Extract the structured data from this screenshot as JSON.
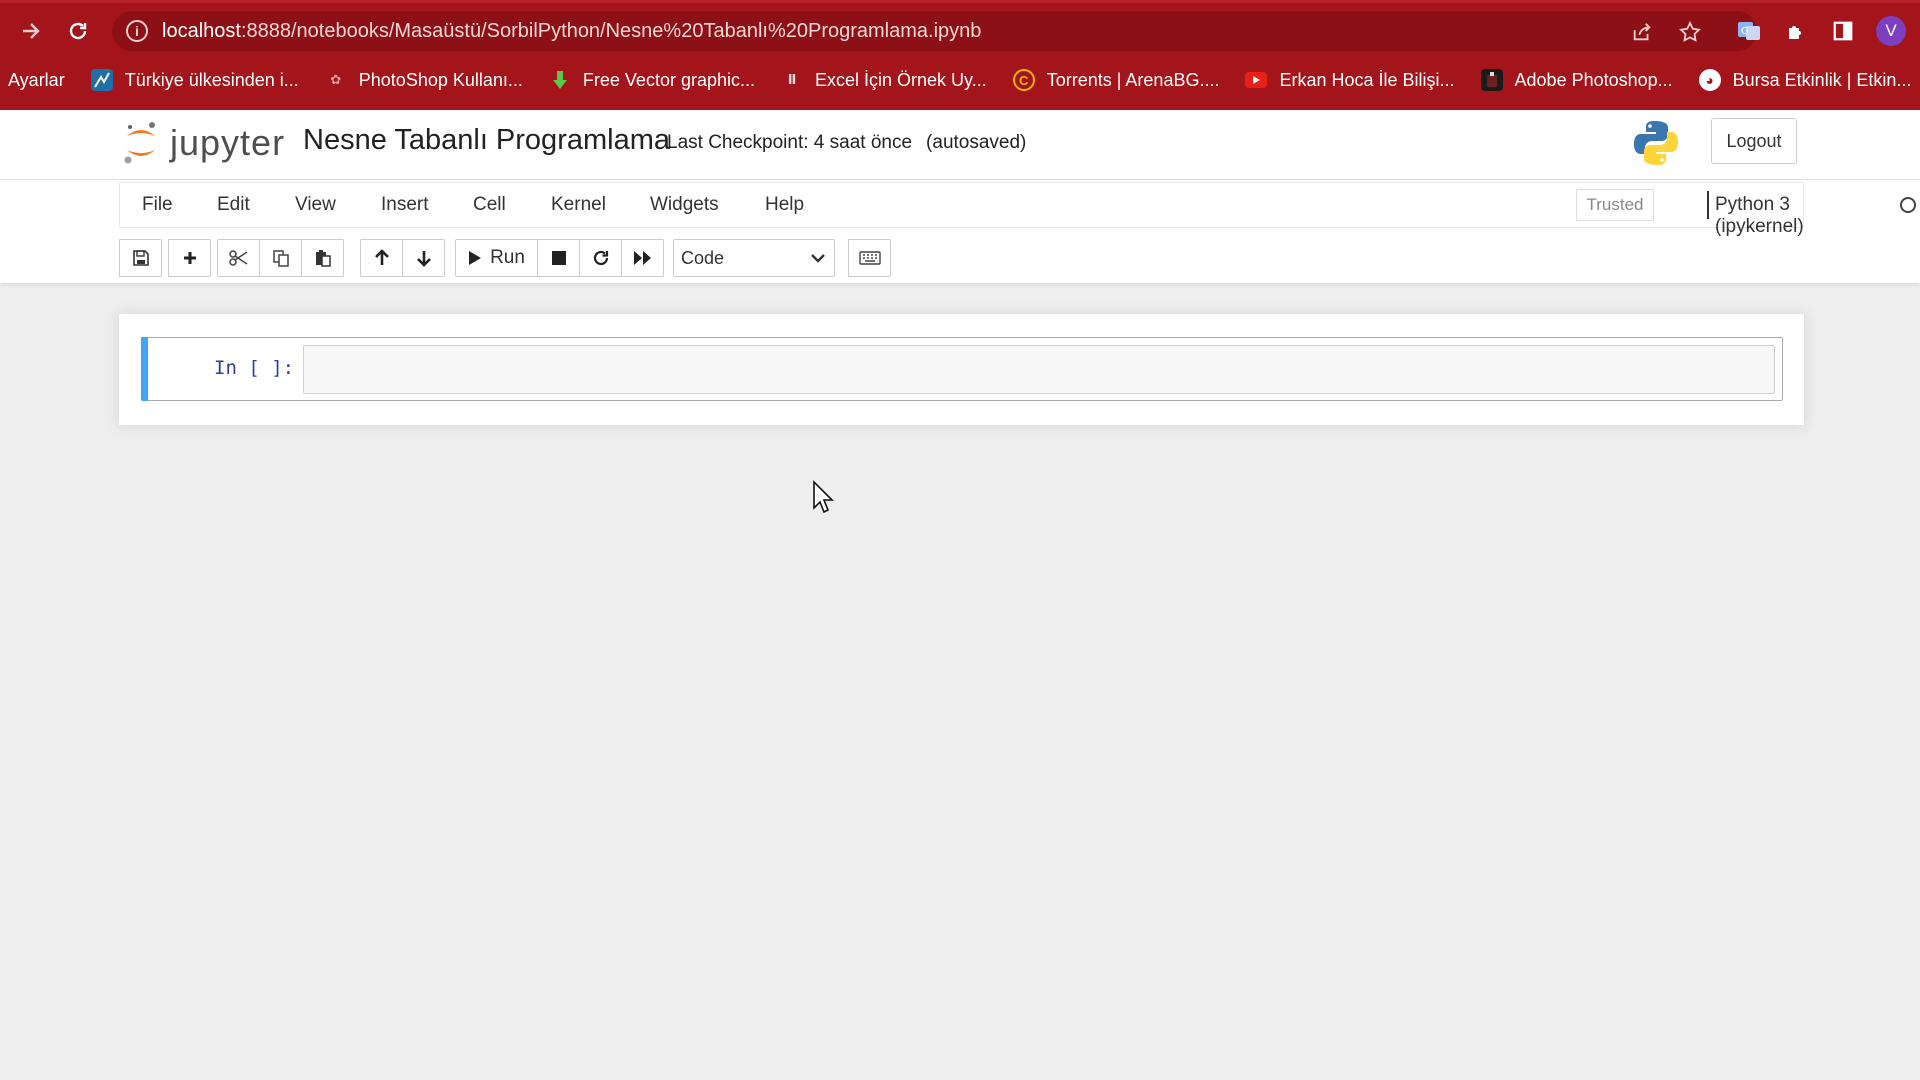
{
  "browser": {
    "url_host": "localhost",
    "url_rest": ":8888/notebooks/Masaüstü/SorbilPython/Nesne%20Tabanlı%20Programlama.ipynb",
    "bookmarks": [
      {
        "label": "Ayarlar",
        "icon": "settings-text"
      },
      {
        "label": "Türkiye ülkesinden i...",
        "icon": "chart-favicon"
      },
      {
        "label": "PhotoShop Kullanı...",
        "icon": "photoshop-favicon"
      },
      {
        "label": "Free Vector graphic...",
        "icon": "download-arrow-favicon"
      },
      {
        "label": "Excel İçin Örnek Uy...",
        "icon": "excel-favicon"
      },
      {
        "label": "Torrents | ArenaBG....",
        "icon": "c-circle-favicon"
      },
      {
        "label": "Erkan Hoca İle Bilişi...",
        "icon": "youtube-favicon"
      },
      {
        "label": "Adobe Photoshop...",
        "icon": "dark-favicon"
      },
      {
        "label": "Bursa Etkinlik | Etkin...",
        "icon": "globe-favicon"
      }
    ],
    "profile_initial": "V",
    "colors": {
      "chrome": "#a3141b",
      "urlbar": "#8c1016"
    }
  },
  "header": {
    "logo_text": "jupyter",
    "notebook_name": "Nesne Tabanlı Programlama",
    "checkpoint": "Last Checkpoint: 4 saat önce",
    "autosave": "(autosaved)",
    "logout_label": "Logout"
  },
  "menu": {
    "items": [
      "File",
      "Edit",
      "View",
      "Insert",
      "Cell",
      "Kernel",
      "Widgets",
      "Help"
    ],
    "trusted_label": "Trusted",
    "kernel_name": "Python 3 (ipykernel)"
  },
  "toolbar": {
    "run_label": "Run",
    "cell_type": "Code"
  },
  "notebook": {
    "cells": [
      {
        "prompt": "In [ ]:",
        "source": ""
      }
    ],
    "accent": "#42a5f5"
  }
}
